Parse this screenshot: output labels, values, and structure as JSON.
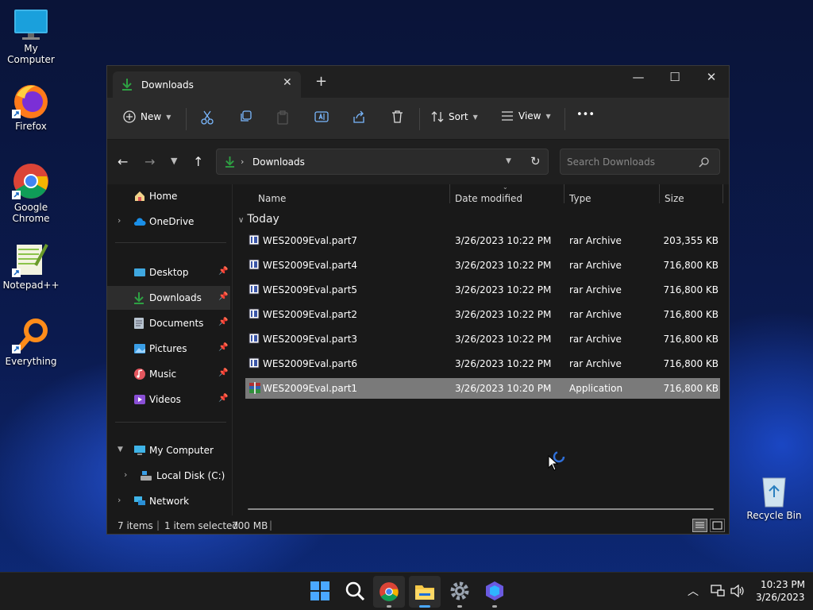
{
  "desktop": {
    "icons": [
      {
        "label": "My Computer"
      },
      {
        "label": "Firefox"
      },
      {
        "label": "Google Chrome"
      },
      {
        "label": "Notepad++"
      },
      {
        "label": "Everything"
      },
      {
        "label": "Recycle Bin"
      }
    ]
  },
  "window": {
    "tab_title": "Downloads",
    "tab_close": "✕",
    "new_tab": "+",
    "controls": {
      "minimize": "—",
      "maximize": "☐",
      "close": "✕"
    },
    "toolbar": {
      "new_label": "New",
      "sort_label": "Sort",
      "view_label": "View",
      "more_label": "•••"
    },
    "address": {
      "path": "Downloads",
      "search_placeholder": "Search Downloads"
    },
    "sidebar": {
      "home": "Home",
      "onedrive": "OneDrive",
      "desktop": "Desktop",
      "downloads": "Downloads",
      "documents": "Documents",
      "pictures": "Pictures",
      "music": "Music",
      "videos": "Videos",
      "my_computer": "My Computer",
      "local_disk": "Local Disk (C:)",
      "network": "Network"
    },
    "columns": {
      "name": "Name",
      "date": "Date modified",
      "type": "Type",
      "size": "Size"
    },
    "group": "Today",
    "files": [
      {
        "name": "WES2009Eval.part7",
        "date": "3/26/2023 10:22 PM",
        "type": "rar Archive",
        "size": "203,355 KB"
      },
      {
        "name": "WES2009Eval.part4",
        "date": "3/26/2023 10:22 PM",
        "type": "rar Archive",
        "size": "716,800 KB"
      },
      {
        "name": "WES2009Eval.part5",
        "date": "3/26/2023 10:22 PM",
        "type": "rar Archive",
        "size": "716,800 KB"
      },
      {
        "name": "WES2009Eval.part2",
        "date": "3/26/2023 10:22 PM",
        "type": "rar Archive",
        "size": "716,800 KB"
      },
      {
        "name": "WES2009Eval.part3",
        "date": "3/26/2023 10:22 PM",
        "type": "rar Archive",
        "size": "716,800 KB"
      },
      {
        "name": "WES2009Eval.part6",
        "date": "3/26/2023 10:22 PM",
        "type": "rar Archive",
        "size": "716,800 KB"
      },
      {
        "name": "WES2009Eval.part1",
        "date": "3/26/2023 10:20 PM",
        "type": "Application",
        "size": "716,800 KB"
      }
    ],
    "status": {
      "items": "7 items",
      "selected": "1 item selected",
      "size": "700 MB"
    }
  },
  "taskbar": {
    "time": "10:23 PM",
    "date": "3/26/2023"
  },
  "colors": {
    "accent": "#2ea043",
    "selection": "#7a7a7a",
    "window_bg": "#191919"
  }
}
